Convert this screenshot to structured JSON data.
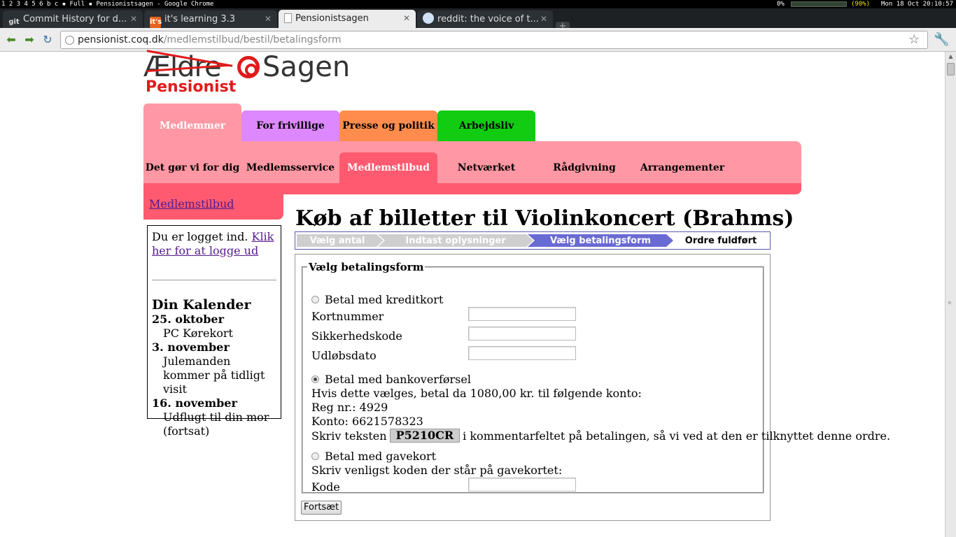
{
  "system_bar": {
    "workspaces": "1 2 3 4 5 6 b c",
    "mode": "Full",
    "window_title": "Pensionistsagen - Google Chrome",
    "cpu": "0%",
    "battery": "(90%)",
    "clock": "Mon 18 Oct 20:10:57"
  },
  "tabs": [
    {
      "label": "Commit History for d...",
      "icon": "git-icon",
      "icon_text": "git"
    },
    {
      "label": "it's learning 3.3",
      "icon": "itslearning-icon",
      "icon_text": "it's"
    },
    {
      "label": "Pensionistsagen",
      "icon": "page-icon",
      "icon_text": ""
    },
    {
      "label": "reddit: the voice of t...",
      "icon": "reddit-icon",
      "icon_text": ""
    }
  ],
  "address": {
    "host": "pensionist.coq.dk",
    "path": "/medlemstilbud/bestil/betalingsform"
  },
  "logo": {
    "eldre": "Ældre",
    "sagen": "Sagen",
    "pensionist": "Pensionist"
  },
  "main_nav": [
    {
      "label": "Medlemmer",
      "color": "#ff98a4"
    },
    {
      "label": "For frivillige",
      "color": "#dd88ff"
    },
    {
      "label": "Presse og politik",
      "color": "#ff8c4c"
    },
    {
      "label": "Arbejdsliv",
      "color": "#11cc11"
    }
  ],
  "sub_nav": [
    "Det gør vi for dig",
    "Medlemsservice",
    "Medlemstilbud",
    "Netværket",
    "Rådgivning",
    "Arrangementer"
  ],
  "breadcrumb": "Medlemstilbud",
  "sidebar": {
    "logged_in": "Du er logget ind.",
    "logout_link": "Klik her for at logge ud",
    "calendar_title": "Din Kalender",
    "events": [
      {
        "date": "25. oktober",
        "title": "PC Kørekort"
      },
      {
        "date": "3. november",
        "title": "Julemanden kommer på tidligt visit"
      },
      {
        "date": "16. november",
        "title": "Udflugt til din mor (fortsat)"
      }
    ]
  },
  "page_title": "Køb af billetter til Violinkoncert (Brahms)",
  "steps": [
    {
      "label": "Vælg antal",
      "state": "done"
    },
    {
      "label": "Indtast oplysninger",
      "state": "done"
    },
    {
      "label": "Vælg betalingsform",
      "state": "current"
    },
    {
      "label": "Ordre fuldført",
      "state": "pending"
    }
  ],
  "form": {
    "legend": "Vælg betalingsform",
    "credit_card": {
      "label": "Betal med kreditkort",
      "card_number": "Kortnummer",
      "security_code": "Sikkerhedskode",
      "expiry": "Udløbsdato"
    },
    "bank": {
      "label": "Betal med bankoverførsel",
      "instructions": "Hvis dette vælges, betal da 1080,00 kr. til følgende konto:",
      "reg": "Reg nr.: 4929",
      "account": "Konto: 6621578323",
      "text_before": "Skriv teksten",
      "code": "P5210CR",
      "text_after": "i kommentarfeltet på betalingen, så vi ved at den er tilknyttet denne ordre."
    },
    "giftcard": {
      "label": "Betal med gavekort",
      "instructions": "Skriv venligst koden der står på gavekortet:",
      "code_label": "Kode"
    },
    "selected": "bank",
    "submit": "Fortsæt"
  }
}
